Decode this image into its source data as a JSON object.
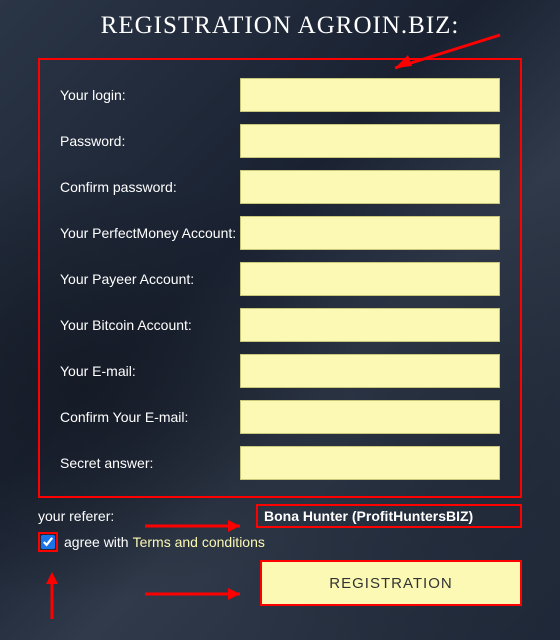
{
  "title": "REGISTRATION AGROIN.BIZ:",
  "fields": {
    "login_label": "Your login:",
    "password_label": "Password:",
    "confirm_password_label": "Confirm password:",
    "pm_label": "Your PerfectMoney Account:",
    "payeer_label": "Your Payeer Account:",
    "bitcoin_label": "Your Bitcoin Account:",
    "email_label": "Your E-mail:",
    "confirm_email_label": "Confirm Your E-mail:",
    "secret_label": "Secret answer:",
    "login_value": "",
    "password_value": "",
    "confirm_password_value": "",
    "pm_value": "",
    "payeer_value": "",
    "bitcoin_value": "",
    "email_value": "",
    "confirm_email_value": "",
    "secret_value": ""
  },
  "referer": {
    "label": "your referer:",
    "value": "Bona Hunter (ProfitHuntersBIZ)"
  },
  "agree": {
    "checked": true,
    "text": "agree with",
    "terms_text": "Terms and conditions"
  },
  "submit_label": "REGISTRATION",
  "colors": {
    "highlight": "#ff0000",
    "input_bg": "#fbf9b4"
  }
}
